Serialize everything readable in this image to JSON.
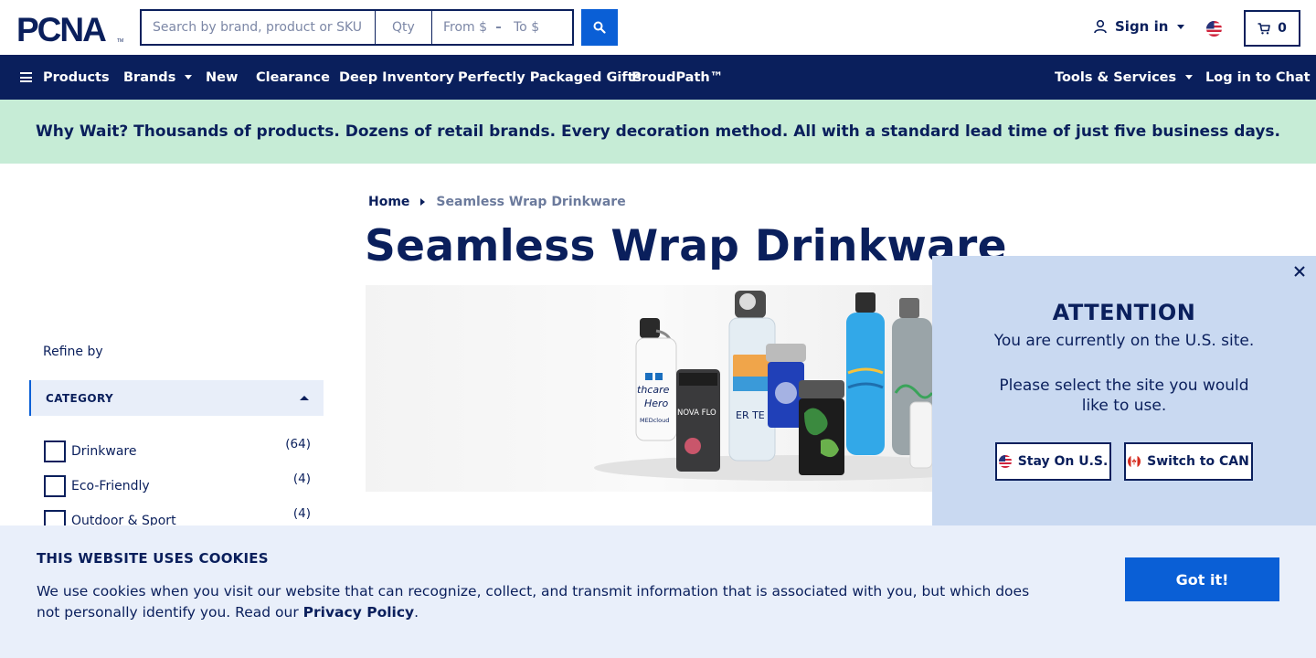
{
  "header": {
    "logo_text": "PCNA",
    "search": {
      "placeholder": "Search by brand, product or SKU",
      "value": ""
    },
    "qty": {
      "placeholder": "Qty",
      "value": ""
    },
    "price_from": {
      "placeholder": "From $"
    },
    "price_to": {
      "placeholder": "To $"
    },
    "search_button_icon": "search-icon",
    "signin_label": "Sign in",
    "locale_flag": "us-flag-icon",
    "cart_count": "0"
  },
  "nav": {
    "products": "Products",
    "brands": "Brands",
    "new": "New",
    "clearance": "Clearance",
    "deep_inventory": "Deep Inventory",
    "gifts": "Perfectly Packaged Gifts",
    "proudpath": "ProudPath™",
    "tools": "Tools & Services",
    "chat": "Log in to Chat"
  },
  "promo": "Why Wait? Thousands of products. Dozens of retail brands. Every decoration method. All with a standard lead time of just five business days.",
  "breadcrumb": {
    "home": "Home",
    "current": "Seamless Wrap Drinkware"
  },
  "page_title": "Seamless Wrap Drinkware",
  "hero": {
    "bottle_text_1": "thcare",
    "bottle_text_2": "Hero",
    "bottle_text_3": "MEDcloud",
    "tumbler_text": "NOVA FLO",
    "clear_text": "ER TE"
  },
  "sidebar": {
    "refine_label": "Refine by",
    "category_label": "CATEGORY",
    "filters": [
      {
        "label": "Drinkware",
        "count": "(64)"
      },
      {
        "label": "Eco-Friendly",
        "count": "(4)"
      },
      {
        "label": "Outdoor & Sport",
        "count": "(4)"
      }
    ]
  },
  "attention": {
    "title": "ATTENTION",
    "line1": "You are currently on the U.S. site.",
    "line2": "Please select the site you would like to use.",
    "stay_button": "Stay On U.S.",
    "switch_button": "Switch to CAN"
  },
  "cookie": {
    "title": "THIS WEBSITE USES COOKIES",
    "text": "We use cookies when you visit our website that can recognize, collect, and transmit information that is associated with you, but which does not personally identify you. Read our ",
    "policy_link": "Privacy Policy",
    "text_end": ".",
    "button": "Got it!"
  },
  "colors": {
    "navy": "#0a1f5c",
    "accent_blue": "#0a5fd6",
    "promo_bg": "#c6ecd6",
    "modal_bg": "#c9d9f1",
    "cookie_bg": "#e9effa"
  }
}
